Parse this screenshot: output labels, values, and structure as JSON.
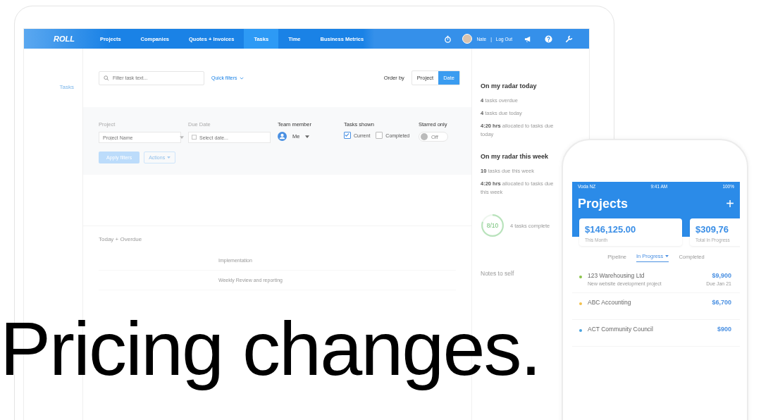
{
  "headline": "Pricing changes.",
  "laptop": {
    "nav": {
      "logo": "ROLL",
      "items": [
        {
          "label": "Projects",
          "selected": false
        },
        {
          "label": "Companies",
          "selected": false
        },
        {
          "label": "Quotes + Invoices",
          "selected": false
        },
        {
          "label": "Tasks",
          "selected": true
        },
        {
          "label": "Time",
          "selected": false
        },
        {
          "label": "Business Metrics",
          "selected": false
        }
      ],
      "user": "Nate",
      "separator": "|",
      "logout": "Log Out"
    },
    "sidebar": [
      {
        "label": "Tasks",
        "selected": true
      }
    ],
    "search": {
      "placeholder": "Filter task text..."
    },
    "quick_filters": "Quick filters",
    "order_by": {
      "label": "Order by",
      "options": [
        {
          "label": "Project",
          "selected": false
        },
        {
          "label": "Date",
          "selected": true
        }
      ]
    },
    "filters": {
      "project": {
        "label": "Project",
        "placeholder": "Project Name"
      },
      "due_date": {
        "label": "Due Date",
        "placeholder": "Select date..."
      },
      "team_member": {
        "label": "Team member",
        "value": "Me"
      },
      "tasks_shown": {
        "label": "Tasks shown",
        "options": [
          {
            "label": "Current",
            "checked": true
          },
          {
            "label": "Completed",
            "checked": false
          }
        ]
      },
      "starred_only": {
        "label": "Starred only",
        "on": false,
        "text": "Off"
      },
      "apply": "Apply filters",
      "actions": "Actions"
    },
    "group": {
      "title": "Today + Overdue",
      "rows": [
        {
          "task": "Implementation"
        },
        {
          "task": "Weekly Review and reporting"
        }
      ]
    },
    "radar_today": {
      "title": "On my radar today",
      "items": [
        "**4** tasks overdue",
        "**4** tasks due today",
        "**4:20 hrs** allocated to tasks due today"
      ]
    },
    "radar_week": {
      "title": "On my radar this week",
      "items": [
        "**10** tasks due this week",
        "**4:20 hrs** allocated to tasks due this week"
      ]
    },
    "progress": {
      "text": "8/10",
      "level": 0.8,
      "caption": "4 tasks complete"
    },
    "notes": "Notes to self"
  },
  "phone": {
    "status": {
      "carrier": "Voda NZ",
      "time": "9:41 AM",
      "battery": "100%"
    },
    "title": "Projects",
    "add": "+",
    "cards": [
      {
        "amount": "$146,125.00",
        "label": "This Month"
      },
      {
        "amount": "$309,76",
        "label": "Total In Progress"
      }
    ],
    "tabs": [
      {
        "label": "Pipeline",
        "selected": false
      },
      {
        "label": "In Progress",
        "selected": true
      },
      {
        "label": "Completed",
        "selected": false
      }
    ],
    "projects": [
      {
        "name": "123 Warehousing Ltd",
        "description": "New website development project",
        "amount": "$9,900",
        "due": "Due Jan 21",
        "color": "#8bc34a"
      },
      {
        "name": "ABC Accounting",
        "amount": "$6,700",
        "color": "#f2c14e"
      },
      {
        "name": "ACT Community Council",
        "amount": "$900",
        "color": "#4aa3df"
      }
    ]
  }
}
